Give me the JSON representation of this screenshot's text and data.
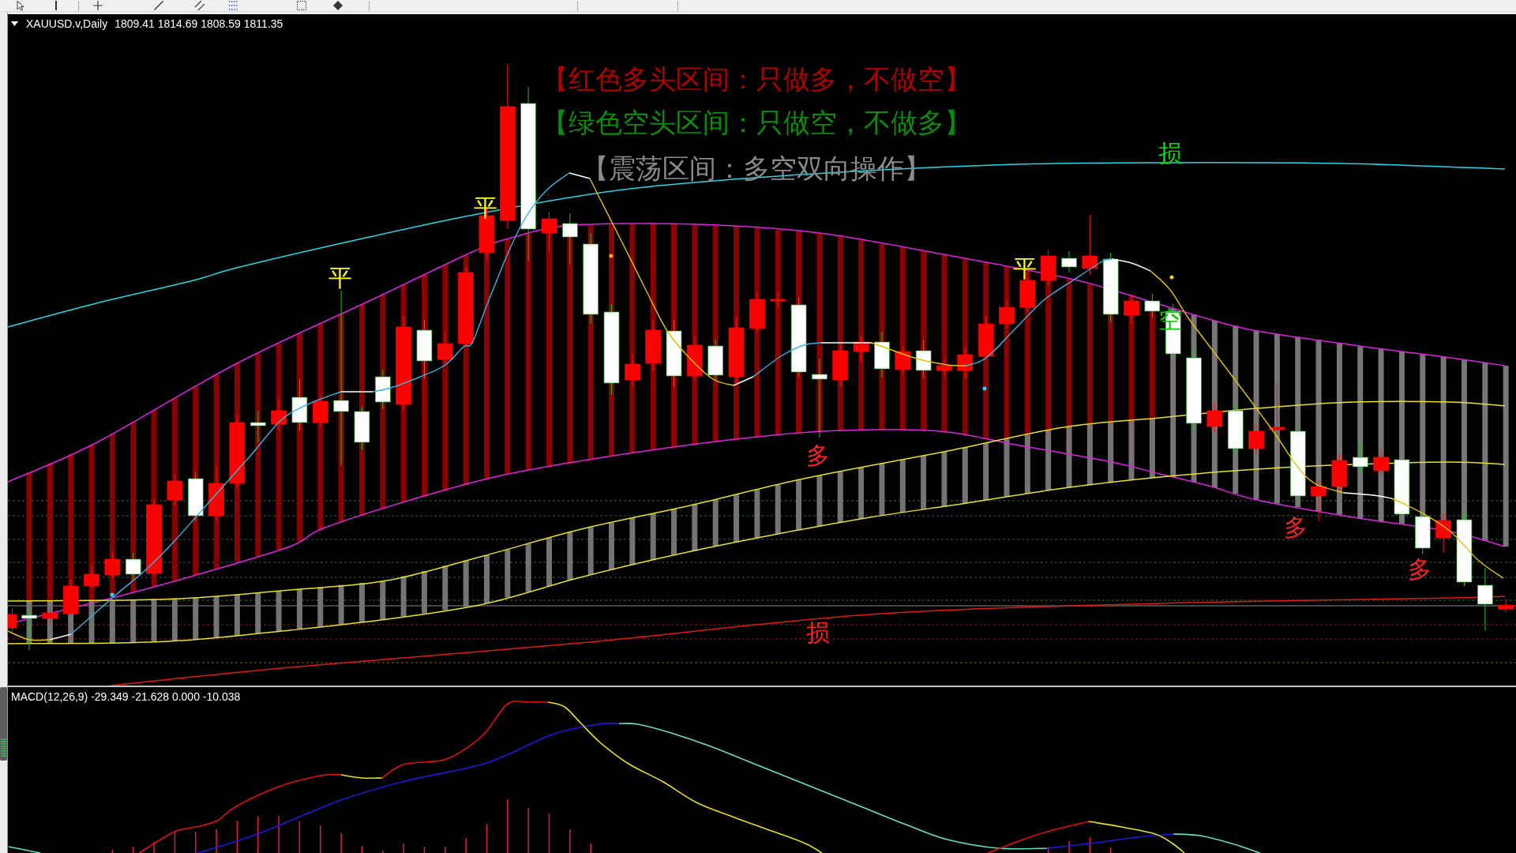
{
  "chart": {
    "symbol": "XAUUSD.v,Daily",
    "ohlc": "1809.41 1814.69 1808.59 1811.35",
    "legend": [
      {
        "text": "【红色多头区间：只做多，不做空】",
        "color": "#b00000"
      },
      {
        "text": "【绿色空头区间：只做空，不做多】",
        "color": "#0c8c0c"
      },
      {
        "text": "【震荡区间：多空双向操作】",
        "color": "#8a8a8a"
      }
    ],
    "signals": [
      {
        "text": "损",
        "color": "#00e000"
      },
      {
        "text": "平",
        "color": "#ffff00"
      },
      {
        "text": "平",
        "color": "#ffff00"
      },
      {
        "text": "平",
        "color": "#ffff00"
      },
      {
        "text": "空",
        "color": "#00c800"
      },
      {
        "text": "多",
        "color": "#ff2020"
      },
      {
        "text": "多",
        "color": "#ff2020"
      },
      {
        "text": "多",
        "color": "#ff2020"
      },
      {
        "text": "损",
        "color": "#ff2020"
      }
    ]
  },
  "macd_panel": {
    "label": "MACD(12,26,9) -29.349 -21.628 0.000 -10.038"
  }
}
